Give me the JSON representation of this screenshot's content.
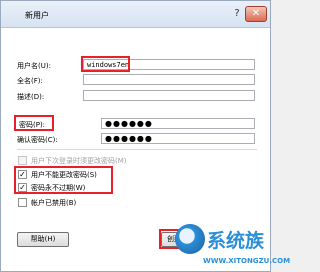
{
  "window": {
    "title": "新用户",
    "help_label": "?",
    "close_label": "✕"
  },
  "fields": {
    "username_label": "用户名(U):",
    "username_value": "windows7en",
    "fullname_label": "全名(F):",
    "fullname_value": "",
    "description_label": "描述(D):",
    "description_value": "",
    "password_label": "密码(P):",
    "password_value": "●●●●●●",
    "confirm_label": "确认密码(C):",
    "confirm_value": "●●●●●●"
  },
  "checkboxes": [
    {
      "label": "用户下次登录时须更改密码(M)",
      "checked": false,
      "enabled": false,
      "mark": ""
    },
    {
      "label": "用户不能更改密码(S)",
      "checked": true,
      "enabled": true,
      "mark": "✓"
    },
    {
      "label": "密码永不过期(W)",
      "checked": true,
      "enabled": true,
      "mark": "✓"
    },
    {
      "label": "帐户已禁用(B)",
      "checked": false,
      "enabled": true,
      "mark": ""
    }
  ],
  "buttons": {
    "help_label": "帮助(H)",
    "create_label": "创建(E)"
  },
  "watermark": {
    "text": "系统族",
    "url": "WWW.XITONGZU.COM"
  },
  "colors": {
    "highlight": "#e8202a",
    "watermark": "#2b8fd8"
  }
}
